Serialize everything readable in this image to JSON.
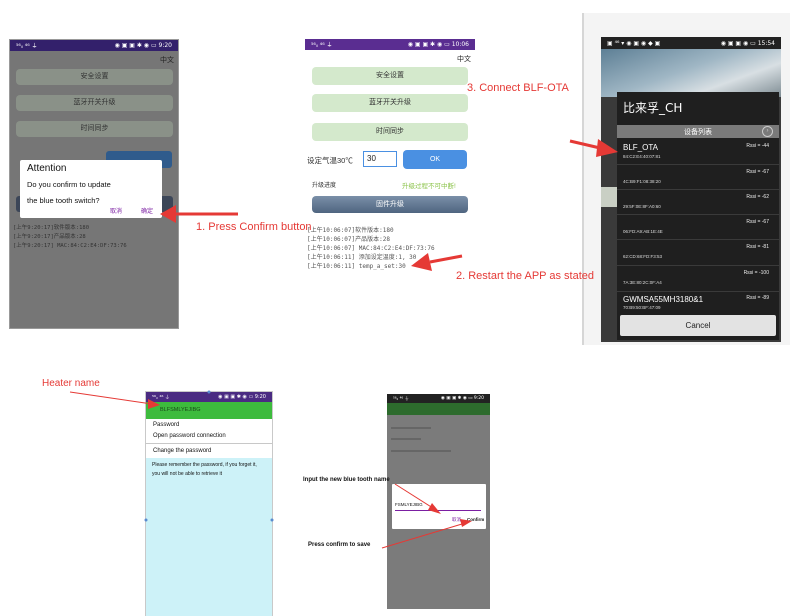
{
  "panel1": {
    "status_left": "⁵⁶ᵢₗ ⁴⁶ ⏚",
    "status_right": "◉ ▣ ▣ ✱ ◉ ▭ 9:20",
    "lang": "中文",
    "buttons": [
      "安全设置",
      "蓝牙开关升级",
      "时间同步"
    ],
    "log": [
      "[上午9:20:17]软件版本:180",
      "[上午9:20:17]产品版本:28",
      "[上午9:20:17] MAC:84:C2:E4:DF:73:76"
    ],
    "dialog": {
      "title": "Attention",
      "body_line1": "Do you confirm to update",
      "body_line2": "the blue tooth switch?",
      "cancel": "取消",
      "confirm": "确定"
    }
  },
  "panel2": {
    "status_left": "⁵⁶ᵢₗ ⁴⁶ ⏚",
    "status_right": "◉ ▣ ▣ ✱ ◉ ▭ 10:06",
    "lang": "中文",
    "buttons": [
      "安全设置",
      "蓝牙开关升级",
      "时间同步"
    ],
    "temp_label": "设定气温30℃",
    "temp_value": "30",
    "ok": "OK",
    "progress_label": "升级进度",
    "warning": "升级过程不可中断!",
    "firmware_button": "固件升级",
    "log": [
      "[上午10:06:07]软件版本:180",
      "[上午10:06:07]产品版本:28",
      "[上午10:06:07] MAC:84:C2:E4:DF:73:76",
      "[上午10:06:11] 添加设定温度:1, 30",
      "[上午10:06:11] temp_a_set:30"
    ]
  },
  "panel3": {
    "status_left": "▣ ⁴⁶ ▾ ◉ ▣ ◉ ◆ ▣",
    "status_right": "◉ ▣ ▣ ◉ ▭ 15:54",
    "title": "比来孚_CH",
    "list_header": "设备列表",
    "devices": [
      {
        "name": "BLF_OTA",
        "mac": "84:C2:E4:40:07:81",
        "rssi": "Rssi = -44"
      },
      {
        "name": "",
        "mac": "4C:B9:F1:08:38:20",
        "rssi": "Rssi = -67"
      },
      {
        "name": "",
        "mac": "29:5F:0E:8F:A0:60",
        "rssi": "Rssi = -62"
      },
      {
        "name": "",
        "mac": "06:FD:A9:AB:1E:4E",
        "rssi": "Rssi = -67"
      },
      {
        "name": "",
        "mac": "62:CD:68:FD:F3:53",
        "rssi": "Rssi = -81"
      },
      {
        "name": "",
        "mac": "7A:3E:80:2C:0F:A4",
        "rssi": "Rssi = -100"
      },
      {
        "name": "GWMSA55MH3180&1",
        "mac": "70:B9:50:BF:47:09",
        "rssi": "Rssi = -89"
      }
    ],
    "cancel": "Cancel"
  },
  "panel4": {
    "status_left": "⁵⁶ᵢₗ ⁴⁶ ⏚",
    "status_right": "◉ ▣ ▣ ✱ ◉ ▭ 9:20",
    "device_name": "BLFSMLYEJIBG",
    "menu": [
      "Password",
      "Open password connection",
      "Change the password"
    ],
    "note_line1": "Please remember the password, if you forget it,",
    "note_line2": "you will not be able to retrieve it"
  },
  "panel5": {
    "status_left": "⁵⁶ᵢₗ ⁴⁶ ⏚",
    "status_right": "◉ ▣ ▣ ✱ ◉ ▭ 9:20",
    "input_value": "FSMLYEJIBG",
    "cancel": "取消",
    "confirm": "Confirm"
  },
  "annotations": {
    "press_confirm_button": "1. Press Confirm button",
    "restart_app": "2. Restart the APP as stated",
    "connect_ota": "3. Connect BLF-OTA",
    "heater_name": "Heater name",
    "input_new_name": "Input the new blue tooth name",
    "press_confirm_save": "Press confirm to save"
  },
  "colors": {
    "arrow": "#e53935",
    "status_bar": "#5a2d91",
    "app_header_green": "#3dbb3d",
    "ok_blue": "#4a90e2",
    "dialog_purple": "#7b1fa2"
  }
}
